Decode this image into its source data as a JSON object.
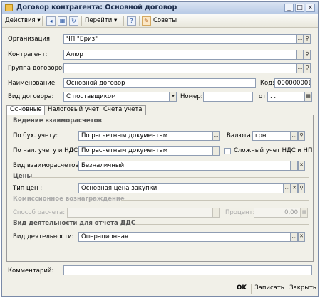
{
  "window": {
    "title": "Договор контрагента: Основной договор",
    "controls": {
      "minimize": "_",
      "maximize": "□",
      "close": "×"
    }
  },
  "toolbar": {
    "actions_label": "Действия",
    "goto_label": "Перейти",
    "help_label": "?",
    "tips_label": "Советы"
  },
  "header": {
    "organization_label": "Организация:",
    "organization_value": "ЧП \"Бриз\"",
    "counterparty_label": "Контрагент:",
    "counterparty_value": "Алюр",
    "group_label": "Группа договоров:",
    "group_value": "",
    "name_label": "Наименование:",
    "name_value": "Основной договор",
    "code_label": "Код:",
    "code_value": "000000001",
    "type_label": "Вид договора:",
    "type_value": "С поставщиком",
    "number_label": "Номер:",
    "number_value": "",
    "date_label": "от:",
    "date_value": ". .   "
  },
  "tabs": [
    {
      "label": "Основные",
      "active": true
    },
    {
      "label": "Налоговый учет",
      "active": false
    },
    {
      "label": "Счета учета",
      "active": false
    }
  ],
  "main": {
    "settlement_section": "Ведение взаиморасчетов",
    "acc_label": "По бух. учету:",
    "acc_value": "По расчетным документам",
    "currency_label": "Валюта :",
    "currency_value": "грн",
    "tax_label": "По нал. учету и НДС:",
    "tax_value": "По расчетным документам",
    "complex_vat_label": "Сложный учет НДС и НП",
    "complex_vat_checked": false,
    "settle_type_label": "Вид взаиморасчетов:",
    "settle_type_value": "Безналичный",
    "prices_section": "Цены",
    "price_type_label": "Тип цен :",
    "price_type_value": "Основная цена закупки",
    "commission_section": "Комиссионное вознаграждение",
    "calc_method_label": "Способ расчета:",
    "calc_method_value": "",
    "percent_label": "Процент:",
    "percent_value": "0,00",
    "dds_section": "Вид деятельности для отчета ДДС",
    "activity_label": "Вид деятельности:",
    "activity_value": "Операционная"
  },
  "footer": {
    "comment_label": "Комментарий:",
    "comment_value": "",
    "ok_label": "OK",
    "save_label": "Записать",
    "close_label": "Закрыть"
  }
}
